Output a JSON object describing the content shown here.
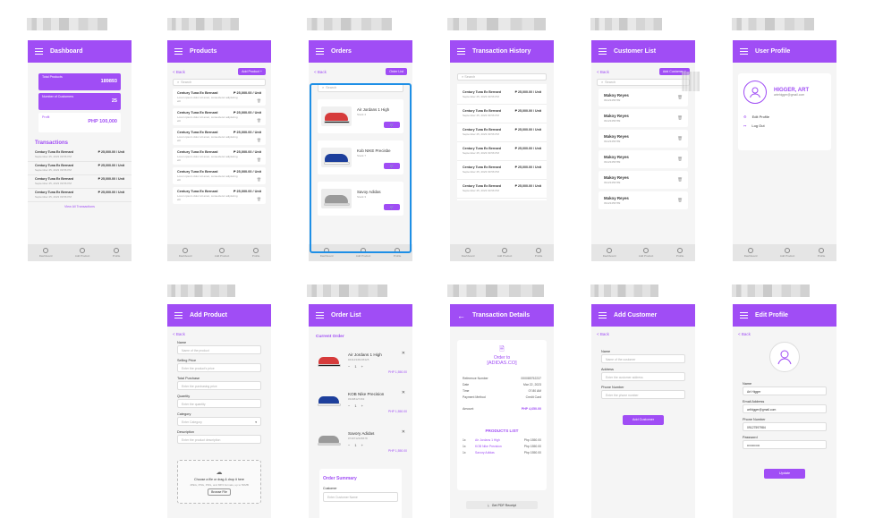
{
  "colors": {
    "accent": "#a04df5",
    "selection": "#1e8fe6",
    "background": "#f5f5f5"
  },
  "dashboard": {
    "title": "Dashboard",
    "total_products_label": "Total Products",
    "total_products_value": "189893",
    "customers_label": "Number of Customers",
    "customers_value": "25",
    "profit_label": "Profit",
    "profit_value": "PHP 100,000",
    "transactions_title": "Transactions",
    "transactions": [
      {
        "name": "Century Tuna Ex Bernard",
        "amount": "₱ 25,000.00 / Unit",
        "date": "September 25, 2023 09:56 PM"
      },
      {
        "name": "Century Tuna Ex Bernard",
        "amount": "₱ 25,000.00 / Unit",
        "date": "September 25, 2023 09:56 PM"
      },
      {
        "name": "Century Tuna Ex Bernard",
        "amount": "₱ 25,000.00 / Unit",
        "date": "September 25, 2023 09:56 PM"
      },
      {
        "name": "Century Tuna Ex Bernard",
        "amount": "₱ 25,000.00 / Unit",
        "date": "September 25, 2023 09:56 PM"
      }
    ],
    "view_all": "View All Transactions"
  },
  "nav": {
    "dashboard": "Dashboard",
    "add": "Add Product",
    "profile": "Profile"
  },
  "products": {
    "title": "Products",
    "back": "< Back",
    "add_button": "Add Product +",
    "search_placeholder": "Search",
    "items": [
      {
        "name": "Century Tuna Ex Bernard",
        "price": "₱ 25,000.00 / Unit",
        "desc": "Lorem ipsum dolor sit amet, consectetur adipiscing elit"
      },
      {
        "name": "Century Tuna Ex Bernard",
        "price": "₱ 25,000.00 / Unit",
        "desc": "Lorem ipsum dolor sit amet, consectetur adipiscing elit"
      },
      {
        "name": "Century Tuna Ex Bernard",
        "price": "₱ 25,000.00 / Unit",
        "desc": "Lorem ipsum dolor sit amet, consectetur adipiscing elit"
      },
      {
        "name": "Century Tuna Ex Bernard",
        "price": "₱ 25,000.00 / Unit",
        "desc": "Lorem ipsum dolor sit amet, consectetur adipiscing elit"
      },
      {
        "name": "Century Tuna Ex Bernard",
        "price": "₱ 25,000.00 / Unit",
        "desc": "Lorem ipsum dolor sit amet, consectetur adipiscing elit"
      },
      {
        "name": "Century Tuna Ex Bernard",
        "price": "₱ 25,000.00 / Unit",
        "desc": "Lorem ipsum dolor sit amet, consectetur adipiscing elit"
      }
    ]
  },
  "orders": {
    "title": "Orders",
    "back": "< Back",
    "order_list_button": "Order List",
    "search_placeholder": "Search",
    "items": [
      {
        "name": "Air Jordans 1 High",
        "sub": "Stock 4"
      },
      {
        "name": "Kob NIKE Precisbe",
        "sub": "Stock 7"
      },
      {
        "name": "Savoy Adidas",
        "sub": "Stock 3"
      }
    ]
  },
  "history": {
    "title": "Transaction History",
    "search_placeholder": "Search",
    "items": [
      {
        "name": "Century Tuna Ex Bernard",
        "amount": "₱ 25,000.00 / Unit",
        "date": "September 25, 2023 09:56 PM"
      },
      {
        "name": "Century Tuna Ex Bernard",
        "amount": "₱ 25,000.00 / Unit",
        "date": "September 25, 2023 09:56 PM"
      },
      {
        "name": "Century Tuna Ex Bernard",
        "amount": "₱ 25,000.00 / Unit",
        "date": "September 25, 2023 09:56 PM"
      },
      {
        "name": "Century Tuna Ex Bernard",
        "amount": "₱ 25,000.00 / Unit",
        "date": "September 25, 2023 09:56 PM"
      },
      {
        "name": "Century Tuna Ex Bernard",
        "amount": "₱ 25,000.00 / Unit",
        "date": "September 25, 2023 09:56 PM"
      },
      {
        "name": "Century Tuna Ex Bernard",
        "amount": "₱ 25,000.00 / Unit",
        "date": "September 25, 2023 09:56 PM"
      }
    ]
  },
  "customers": {
    "title": "Customer List",
    "back": "< Back",
    "add_button": "Add Customer",
    "search_placeholder": "Search",
    "items": [
      {
        "name": "Makoy Reyes",
        "phone": "09123456789"
      },
      {
        "name": "Makoy Reyes",
        "phone": "09123456789"
      },
      {
        "name": "Makoy Reyes",
        "phone": "09123456789"
      },
      {
        "name": "Makoy Reyes",
        "phone": "09123456789"
      },
      {
        "name": "Makoy Reyes",
        "phone": "09123456789"
      },
      {
        "name": "Makoy Reyes",
        "phone": "09123456789"
      }
    ]
  },
  "profile": {
    "title": "User Profile",
    "name": "HIGGER, ART",
    "email": "artehigger@gmail.com",
    "edit": "Edit Profile",
    "logout": "Log Out"
  },
  "add_product": {
    "title": "Add Product",
    "back": "< Back",
    "fields": [
      {
        "label": "Name",
        "placeholder": "Name of the product"
      },
      {
        "label": "Selling Price",
        "placeholder": "Enter the product's price"
      },
      {
        "label": "Total Purchase",
        "placeholder": "Enter the purchasing price"
      },
      {
        "label": "Quantity",
        "placeholder": "Enter the quantity"
      },
      {
        "label": "Category",
        "placeholder": "Enter Category"
      },
      {
        "label": "Description",
        "placeholder": "Enter the product description"
      }
    ],
    "upload_text": "Choose a file or drag & drop it here",
    "upload_formats": "JPEG, PNG, PDG, and MP4 formats, up to 50MB",
    "browse": "Browse File"
  },
  "order_list": {
    "title": "Order List",
    "current_order": "Current Order",
    "items": [
      {
        "name": "Air Jordans 1 High",
        "sku": "#4312345245325",
        "price": "PHP 1,550.00",
        "qty": "1"
      },
      {
        "name": "KOB Nike Precision",
        "sku": "#3498127463",
        "price": "PHP 1,550.00",
        "qty": "1"
      },
      {
        "name": "Savory Adidas",
        "sku": "#749712345678",
        "price": "PHP 1,550.00",
        "qty": "1"
      }
    ],
    "summary_title": "Order Summary",
    "customer_label": "Customer",
    "customer_placeholder": "Enter Customer Name"
  },
  "details": {
    "title": "Transaction Details",
    "order_to": "Order to",
    "brand": "[ADIDAS.CO]",
    "rows": [
      {
        "label": "Reference Number",
        "value": "000085752237"
      },
      {
        "label": "Date",
        "value": "Mar 22, 2023"
      },
      {
        "label": "Time",
        "value": "07:80 AM"
      },
      {
        "label": "Payment Method",
        "value": "Credit Card"
      }
    ],
    "amount_label": "Amount",
    "amount_value": "PHP 4,650.00",
    "products_title": "PRODUCTS LIST",
    "products": [
      {
        "qty": "1x",
        "name": "Air Jordans 1 High",
        "price": "Php 1550.00"
      },
      {
        "qty": "1x",
        "name": "KOB Nike Precision",
        "price": "Php 1550.00"
      },
      {
        "qty": "1x",
        "name": "Savory Adidas",
        "price": "Php 1550.00"
      }
    ],
    "pdf_button": "Get PDF Receipt"
  },
  "add_customer": {
    "title": "Add Customer",
    "back": "< Back",
    "fields": [
      {
        "label": "Name",
        "placeholder": "Name of the customer"
      },
      {
        "label": "Address",
        "placeholder": "Enter the customer address"
      },
      {
        "label": "Phone Number",
        "placeholder": "Enter the phone number"
      }
    ],
    "submit": "Add Customer"
  },
  "edit_profile": {
    "title": "Edit Profile",
    "back": "< Back",
    "fields": [
      {
        "label": "Name",
        "value": "Art Higger"
      },
      {
        "label": "Email Address",
        "value": "arthigger@gmail.com"
      },
      {
        "label": "Phone Number",
        "value": "09127597984"
      },
      {
        "label": "Password",
        "value": "••••••••••••"
      }
    ],
    "submit": "Update"
  }
}
